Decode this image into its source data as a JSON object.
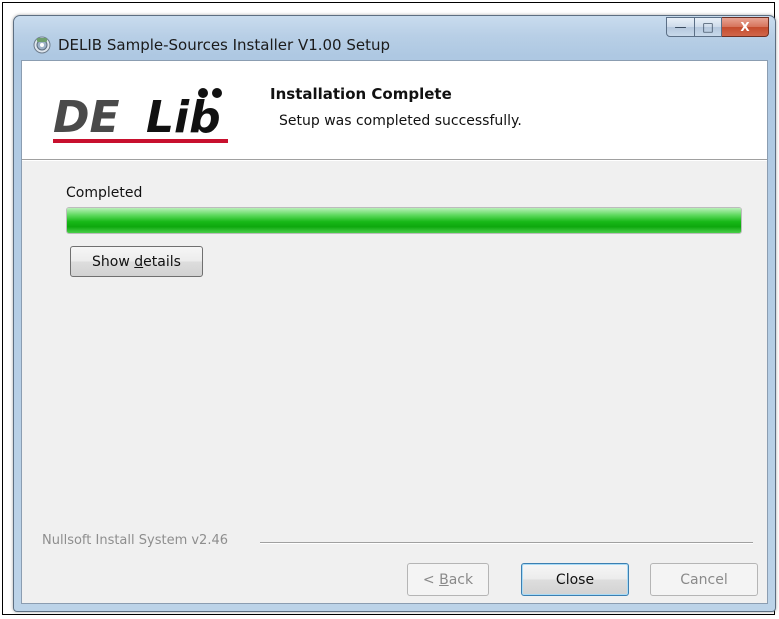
{
  "window": {
    "title": "DELIB Sample-Sources Installer V1.00 Setup",
    "caption_minimize": "—",
    "caption_maximize": "□",
    "caption_close": "X"
  },
  "header": {
    "logo_text_de": "DE",
    "logo_text_lib": "Lib",
    "title": "Installation Complete",
    "subtitle": "Setup was completed successfully."
  },
  "status": {
    "label": "Completed",
    "progress_percent": 100,
    "progress_color": "#17b817"
  },
  "buttons": {
    "show_details_pre": "Show ",
    "show_details_underlined": "d",
    "show_details_post": "etails",
    "back_pre": "< ",
    "back_underlined": "B",
    "back_post": "ack",
    "close": "Close",
    "cancel": "Cancel"
  },
  "footer": {
    "brand": "Nullsoft Install System v2.46"
  },
  "colors": {
    "logo_gray": "#4a4a4a",
    "logo_red": "#c8102e",
    "logo_black": "#111111"
  }
}
